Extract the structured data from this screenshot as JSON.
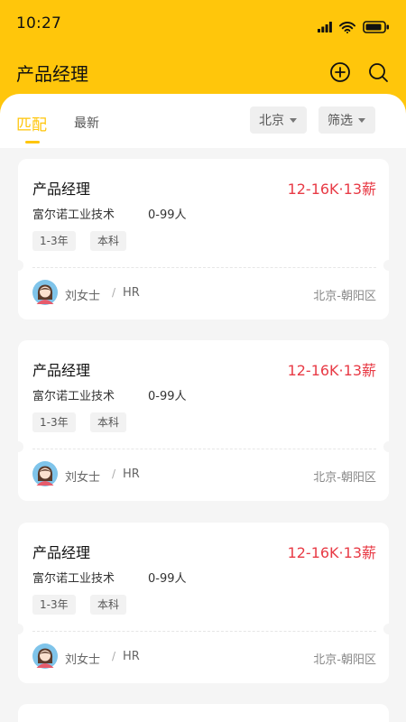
{
  "status_bar": {
    "time": "10:27"
  },
  "header": {
    "title": "产品经理",
    "add_icon": "plus-circle-icon",
    "search_icon": "search-icon"
  },
  "tabs": [
    {
      "label": "匹配",
      "active": true
    },
    {
      "label": "最新",
      "active": false
    }
  ],
  "filters": {
    "city": "北京",
    "filter": "筛选"
  },
  "jobs": [
    {
      "title": "产品经理",
      "salary": "12-16K·13薪",
      "company": "富尔诺工业技术",
      "size": "0-99人",
      "tags": [
        "1-3年",
        "本科"
      ],
      "recruiter": "刘女士",
      "separator": "/",
      "role": "HR",
      "location": "北京-朝阳区"
    },
    {
      "title": "产品经理",
      "salary": "12-16K·13薪",
      "company": "富尔诺工业技术",
      "size": "0-99人",
      "tags": [
        "1-3年",
        "本科"
      ],
      "recruiter": "刘女士",
      "separator": "/",
      "role": "HR",
      "location": "北京-朝阳区"
    },
    {
      "title": "产品经理",
      "salary": "12-16K·13薪",
      "company": "富尔诺工业技术",
      "size": "0-99人",
      "tags": [
        "1-3年",
        "本科"
      ],
      "recruiter": "刘女士",
      "separator": "/",
      "role": "HR",
      "location": "北京-朝阳区"
    }
  ],
  "colors": {
    "brand": "#FFC60B",
    "salary": "#E83B46",
    "background": "#f5f5f5"
  }
}
